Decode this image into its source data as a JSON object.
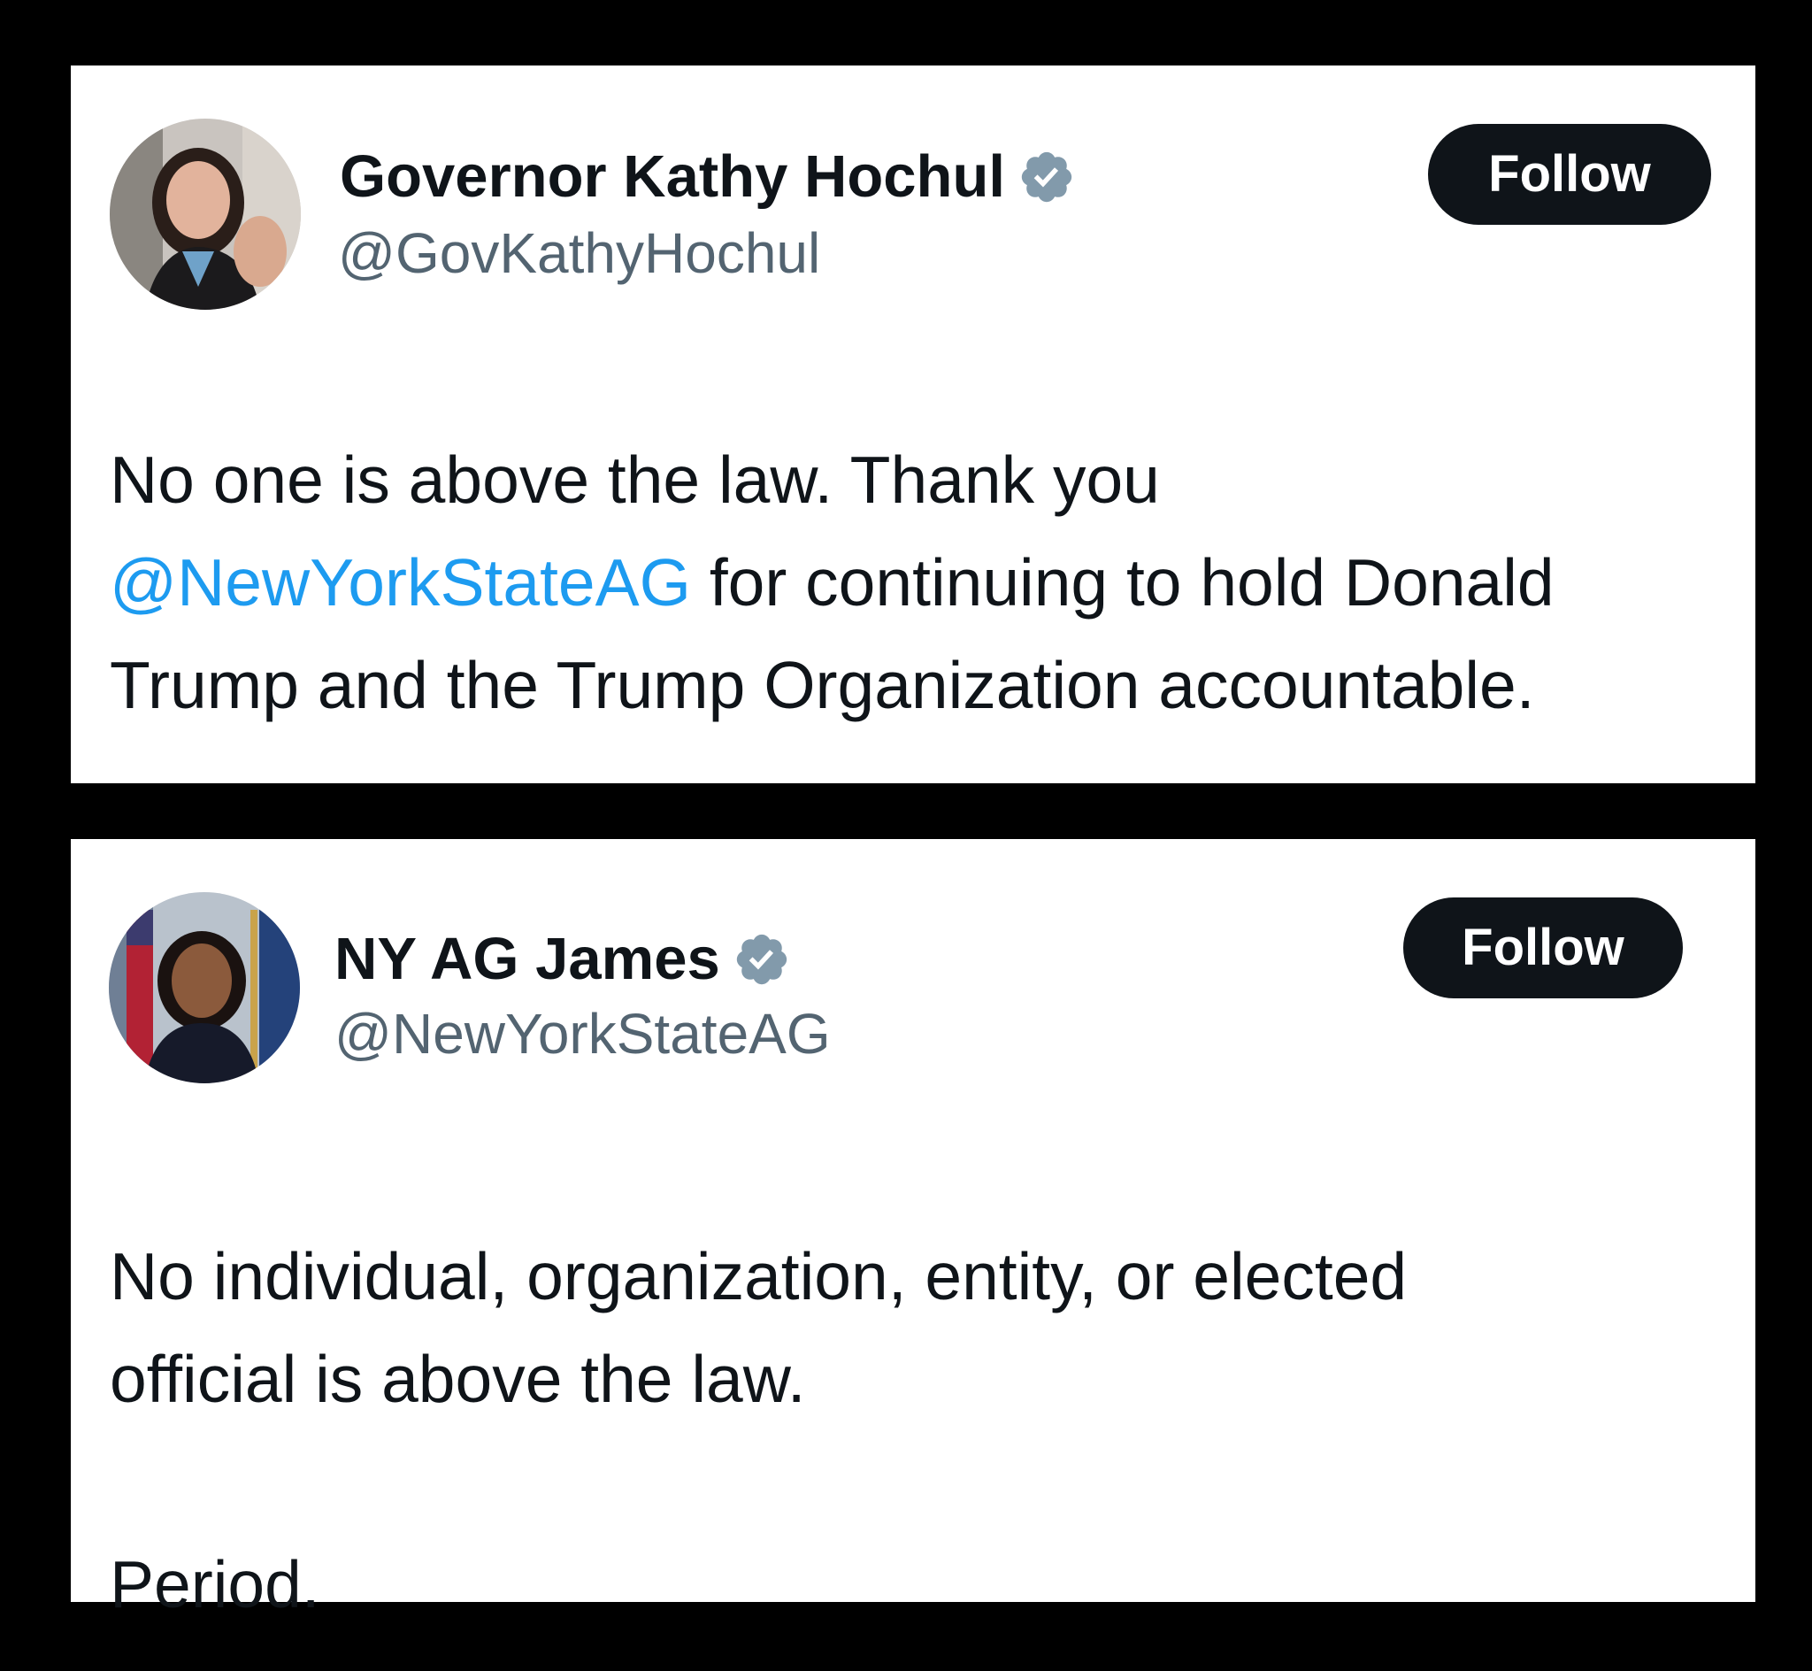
{
  "colors": {
    "background": "#000000",
    "card": "#ffffff",
    "text": "#0f1419",
    "handle": "#536471",
    "mention": "#1d9bf0",
    "follow_button": "#0f1419",
    "verified_badge": "#829aab"
  },
  "tweets": [
    {
      "avatar_icon": "profile-photo",
      "display_name": "Governor Kathy Hochul",
      "verified_icon": "verified-badge-icon",
      "handle": "@GovKathyHochul",
      "follow_label": "Follow",
      "text_before": "No one is above the law. Thank you\n",
      "mention": "@NewYorkStateAG",
      "text_after": " for continuing to hold Donald\nTrump and the Trump Organization accountable."
    },
    {
      "avatar_icon": "profile-photo",
      "display_name": "NY AG James",
      "verified_icon": "verified-badge-icon",
      "handle": "@NewYorkStateAG",
      "follow_label": "Follow",
      "text": "No individual, organization, entity, or elected\nofficial is above the law.\n\nPeriod."
    }
  ]
}
